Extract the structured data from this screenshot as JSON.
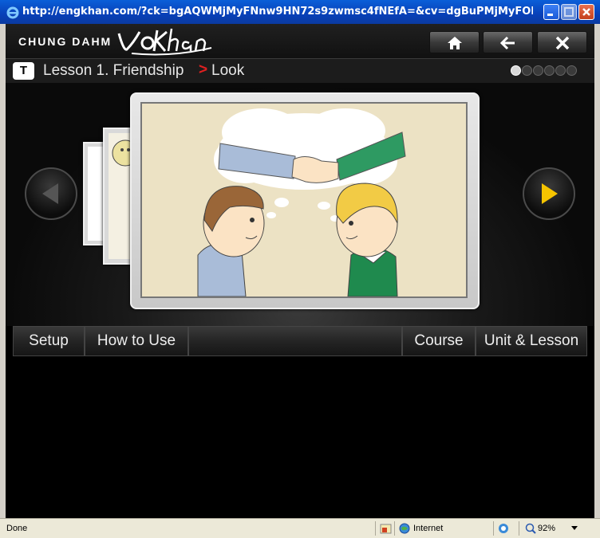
{
  "window": {
    "title": "http://engkhan.com/?ck=bgAQWMjMyFNnw9HN72s9zwmsc4fNEfA=&cv=dgBuPMjMyFOKaKqoSo5HAoO..."
  },
  "header": {
    "brand": "CHUNG DAHM",
    "logo_text": "voKhan"
  },
  "breadcrumb": {
    "icon_letter": "T",
    "lesson": "Lesson 1. Friendship",
    "separator": ">",
    "page": "Look"
  },
  "progress_dots": {
    "total": 6,
    "active_index": 0
  },
  "menu": {
    "setup": "Setup",
    "how_to_use": "How to Use",
    "course": "Course",
    "unit_lesson": "Unit & Lesson"
  },
  "status": {
    "left": "Done",
    "zone": "Internet",
    "zoom": "92%"
  },
  "colors": {
    "accent_arrow": "#f5c400",
    "breadcrumb_separator": "#e02020",
    "titlebar": "#0a5fd8"
  }
}
